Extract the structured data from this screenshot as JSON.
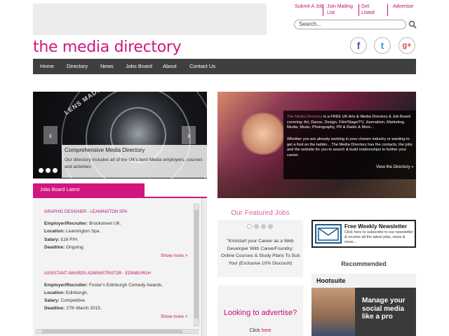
{
  "toplinks": {
    "submit_job": "Submit A Job",
    "join_mailing": "Join Mailing List",
    "get_listed": "Get Listed",
    "advertise": "Advertise"
  },
  "search": {
    "placeholder": "Search..."
  },
  "logo": "the media directory",
  "social": {
    "facebook": "f",
    "twitter": "t",
    "googleplus": "g+"
  },
  "nav": [
    "Home",
    "Directory",
    "News",
    "Jobs Board",
    "About",
    "Contact Us"
  ],
  "slider": {
    "title": "Comprehensive Media Directory",
    "description": "Our directory includes all of the UK's best Media employers, courses and activities",
    "lens_text": "LENS MADE"
  },
  "promo": {
    "highlight": "The Media Directory",
    "text1": " is a FREE UK Arts & Media Directory & Job Board covering: Art, Dance, Design, Film/Stage/TV, Journalism, Marketing, Media, Music, Photography, PR & Radio & More...",
    "text2": "Whether you are already working in your chosen industry or wanting to get a foot on the ladder... The Media Directory has the contacts, the jobs and the website for you to search & build relationships to further your career.",
    "link": "View the Directory »"
  },
  "jobs_board": {
    "tab": "Jobs Board Latest",
    "jobs": [
      {
        "title": "GRAPHIC DESIGNER - LEAMINGTON SPA",
        "employer_label": "Employer/Recruiter:",
        "employer": " Brookstreet UK.",
        "location_label": "Location:",
        "location": " Leamington Spa.",
        "salary_label": "Salary:",
        "salary": " £16 P/H.",
        "deadline_label": "Deadline:",
        "deadline": " Ongoing.",
        "more": "Show more >"
      },
      {
        "title": "ASSISTANT AWARDS ADMINISTRATOR - EDINBURGH",
        "employer_label": "Employer/Recruiter:",
        "employer": " Foster's Edinburgh Comedy Awards.",
        "location_label": "Location:",
        "location": " Edinburgh.",
        "salary_label": "Salary:",
        "salary": " Competitive.",
        "deadline_label": "Deadline:",
        "deadline": " 27th March 2015.",
        "more": "Show more >"
      }
    ]
  },
  "featured": {
    "title": "Our Featured Jobs",
    "text": "\"Kickstart your Career as a Web Developer With CareerFoundry: Online Courses & Study Plans To Suit You! (Exclusive 10% Discount)"
  },
  "advertise": {
    "title": "Looking to advertise?",
    "click": "Click ",
    "here": "here"
  },
  "newsletter": {
    "title": "Free Weekly Newsletter",
    "subtitle": "Click here to subscribe to our newsletter & receive all the latest jobs, news & more..."
  },
  "recommended": {
    "title": "Recommended",
    "brand": "Hootsuite",
    "text": "Manage your social media like a pro"
  },
  "colors": {
    "brand": "#d11680",
    "nav_bg": "#3f3f3f"
  }
}
